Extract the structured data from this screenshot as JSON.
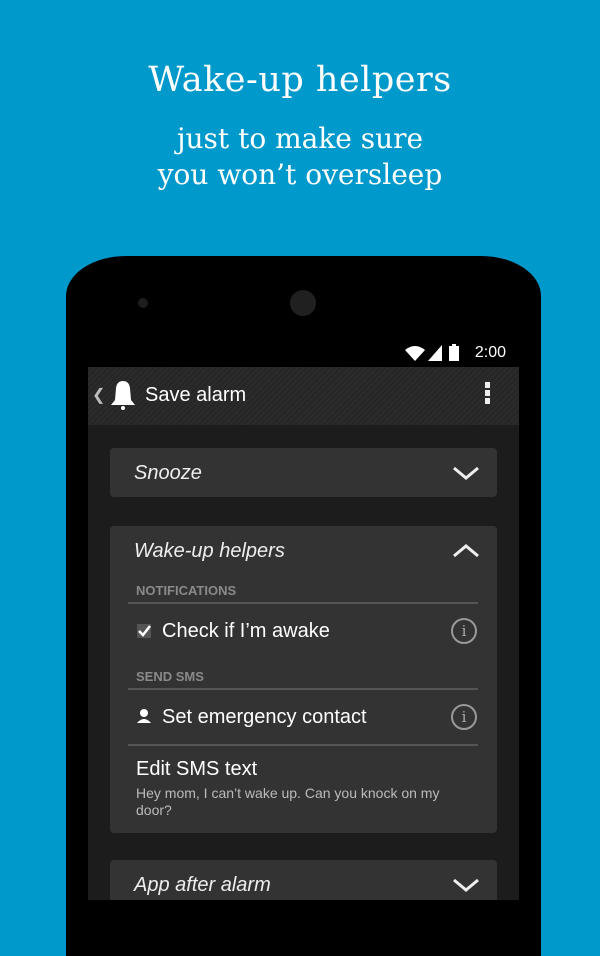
{
  "promo": {
    "headline": "Wake-up helpers",
    "subline1": "just to make sure",
    "subline2": "you won’t oversleep",
    "background_color": "#0099cc"
  },
  "status_bar": {
    "time": "2:00",
    "icons": [
      "wifi-icon",
      "signal-icon",
      "battery-icon"
    ]
  },
  "action_bar": {
    "back_icon": "chevron-left-icon",
    "app_icon": "bell-icon",
    "title": "Save alarm",
    "menu_icon": "overflow-menu-icon"
  },
  "sections": [
    {
      "title": "Snooze",
      "expanded": false,
      "toggle_icon": "chevron-down-icon"
    },
    {
      "title": "Wake-up helpers",
      "expanded": true,
      "toggle_icon": "chevron-up-icon",
      "groups": [
        {
          "header": "NOTIFICATIONS",
          "item": {
            "label": "Check if I’m awake",
            "icon": "checkbox-icon",
            "checked": true,
            "info_icon": "info-icon"
          }
        },
        {
          "header": "SEND SMS",
          "item": {
            "label": "Set emergency contact",
            "icon": "person-icon",
            "info_icon": "info-icon"
          }
        }
      ],
      "edit_sms": {
        "title": "Edit SMS text",
        "text": "Hey mom, I can’t wake up. Can you knock on my door?"
      }
    },
    {
      "title": "App after alarm",
      "expanded": false,
      "toggle_icon": "chevron-down-icon"
    }
  ]
}
